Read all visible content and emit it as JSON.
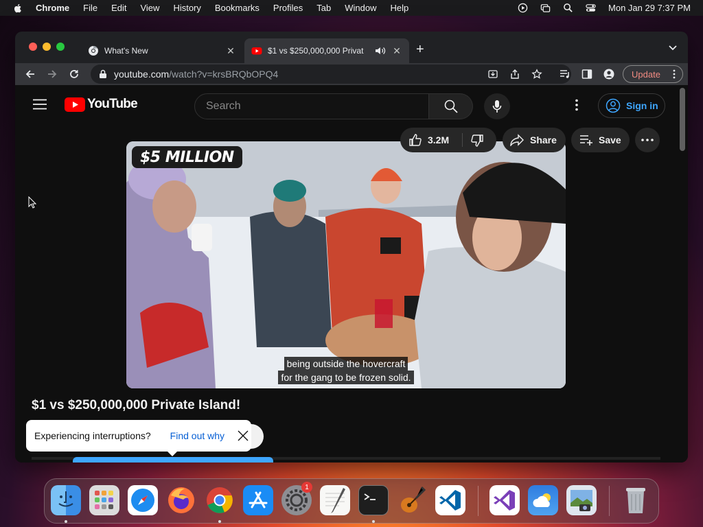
{
  "menubar": {
    "app": "Chrome",
    "items": [
      "File",
      "Edit",
      "View",
      "History",
      "Bookmarks",
      "Profiles",
      "Tab",
      "Window",
      "Help"
    ],
    "clock": "Mon Jan 29  7:37 PM"
  },
  "browser": {
    "tabs": [
      {
        "title": "What's New",
        "active": false
      },
      {
        "title": "$1 vs $250,000,000 Privat",
        "active": true,
        "muted_icon": "speaker-icon"
      }
    ],
    "url": {
      "host": "youtube.com",
      "path": "/watch?v=krsBRQbOPQ4"
    },
    "update_label": "Update"
  },
  "youtube": {
    "logo_text": "YouTube",
    "search_placeholder": "Search",
    "signin_label": "Sign in",
    "video": {
      "overlay_text": "$5 MILLION",
      "caption_line1": "being outside the hovercraft",
      "caption_line2": "for the gang to be frozen solid."
    },
    "title": "$1 vs $250,000,000 Private Island!",
    "likes": "3.2M",
    "share_label": "Share",
    "save_label": "Save",
    "toast": {
      "text": "Experiencing interruptions?",
      "link": "Find out why"
    }
  },
  "dock": {
    "apps": [
      "Finder",
      "Launchpad",
      "Safari",
      "Firefox",
      "Chrome",
      "App Store",
      "System Settings",
      "TextEdit",
      "Terminal",
      "GarageBand",
      "VS Code",
      "Visual Studio",
      "Weather",
      "Preview",
      "Trash"
    ],
    "settings_badge": "1"
  },
  "colors": {
    "accent_red": "#ff0000",
    "link_blue": "#3ea6ff",
    "update_text": "#f28b82"
  }
}
